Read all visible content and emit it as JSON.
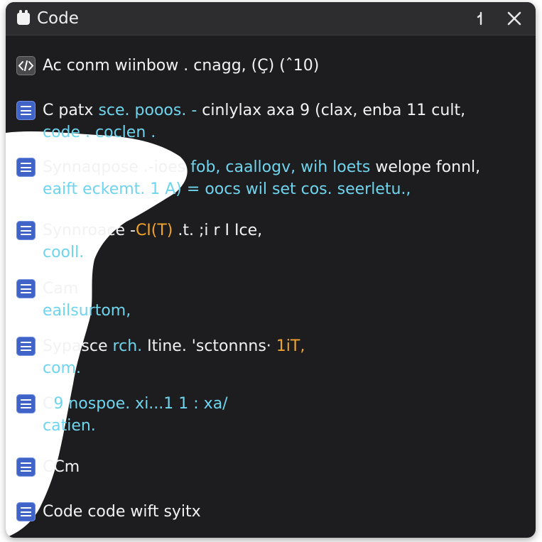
{
  "window": {
    "title": "Code",
    "title_icon": "app-icon",
    "pin_icon": "pin-icon",
    "close_icon": "close-icon"
  },
  "colors": {
    "background": "#1d1d1f",
    "titlebar": "#2d2d30",
    "item_icon": "#3f63c7",
    "text": "#f2f2f2",
    "code_text": "#6fd4ee",
    "accent": "#f0a42c"
  },
  "items": [
    {
      "icon": "code-icon",
      "line1": "Ac conm wiinbow . cnagg, (Ç) (ˆ10)",
      "line2": ""
    },
    {
      "icon": "document-icon",
      "line1_a": "C  patx ",
      "line1_b": "sce. pooos. -",
      "line1_c": " cinlylax axa 9 (clax, enba 11 cult,",
      "line2": "code . coclen ."
    },
    {
      "icon": "document-icon",
      "line1_a": "Synnaqpose .-ioes ",
      "line1_b": "fob, caallogv, wih loets",
      "line1_c": " welope fonnl,",
      "line2": "eaift  eckemt. 1 A) = oocs wil set cos. seerletu.,"
    },
    {
      "icon": "document-icon",
      "line1_a": "Synnroace -",
      "line1_b": "CI(T)",
      "line1_c": " .t. ;i r I Ice,",
      "line2": "cooll."
    },
    {
      "icon": "document-icon",
      "line1": "Cam",
      "line2": "eailsurtom,"
    },
    {
      "icon": "document-icon",
      "line1_a": "Sypasce ",
      "line1_b": "rch.",
      "line1_c": " Itine. 'sctonnns·",
      "line1_d": " 1iT,",
      "line2": "com."
    },
    {
      "icon": "document-icon",
      "line1_a": "C",
      "line1_b": "9 nospoe. xi...1 1 : xa/",
      "line2": "catien."
    },
    {
      "icon": "document-icon",
      "line1": "CCm",
      "line2": ""
    },
    {
      "icon": "document-icon",
      "line1": "Code code wift syitx",
      "line2": ""
    }
  ]
}
